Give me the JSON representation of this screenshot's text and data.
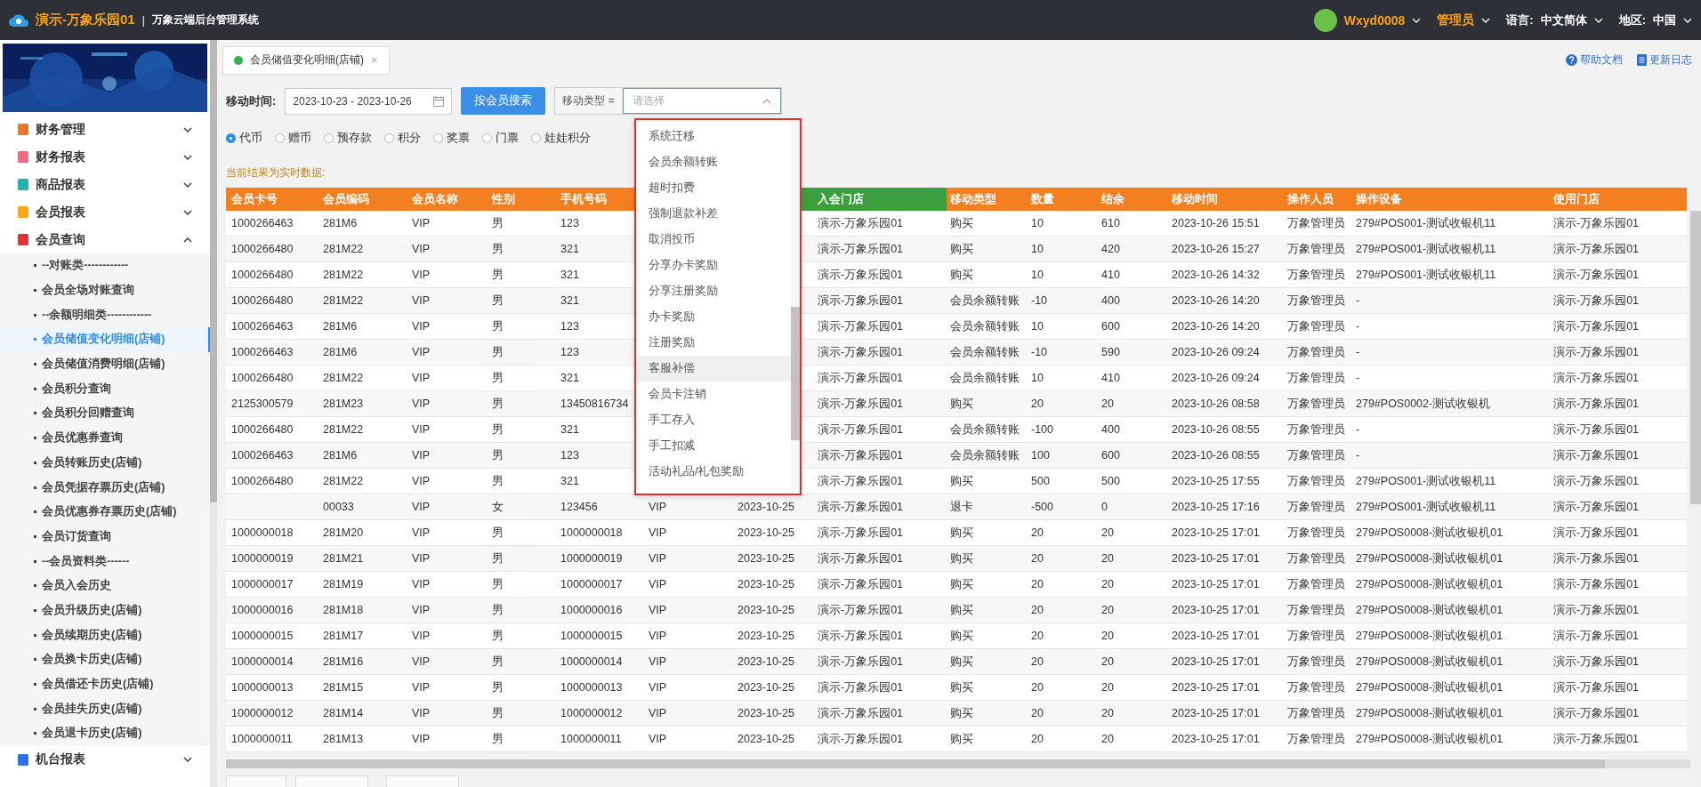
{
  "topbar": {
    "store": "演示-万象乐园01",
    "separator": "|",
    "system": "万象云端后台管理系统",
    "user": "Wxyd0008",
    "role": "管理员",
    "language_label": "语言:",
    "language": "中文简体",
    "region_label": "地区:",
    "region": "中国"
  },
  "sidebar": {
    "items": [
      {
        "label": "财务管理",
        "color": "#e8772e",
        "expanded": false
      },
      {
        "label": "财务报表",
        "color": "#ef6b86",
        "expanded": false
      },
      {
        "label": "商品报表",
        "color": "#27b3a8",
        "expanded": false
      },
      {
        "label": "会员报表",
        "color": "#f5a623",
        "expanded": false
      },
      {
        "label": "会员查询",
        "color": "#d9363e",
        "expanded": true,
        "children": [
          {
            "label": "--对账类------------",
            "selected": false
          },
          {
            "label": "会员全场对账查询",
            "selected": false
          },
          {
            "label": "--余额明细类------------",
            "selected": false
          },
          {
            "label": "会员储值变化明细(店铺)",
            "selected": true
          },
          {
            "label": "会员储值消费明细(店铺)",
            "selected": false
          },
          {
            "label": "会员积分查询",
            "selected": false
          },
          {
            "label": "会员积分回赠查询",
            "selected": false
          },
          {
            "label": "会员优惠券查询",
            "selected": false
          },
          {
            "label": "会员转账历史(店铺)",
            "selected": false
          },
          {
            "label": "会员凭据存票历史(店铺)",
            "selected": false
          },
          {
            "label": "会员优惠券存票历史(店铺)",
            "selected": false
          },
          {
            "label": "会员订货查询",
            "selected": false
          },
          {
            "label": "--会员资料类------",
            "selected": false
          },
          {
            "label": "会员入会历史",
            "selected": false
          },
          {
            "label": "会员升级历史(店铺)",
            "selected": false
          },
          {
            "label": "会员续期历史(店铺)",
            "selected": false
          },
          {
            "label": "会员换卡历史(店铺)",
            "selected": false
          },
          {
            "label": "会员借还卡历史(店铺)",
            "selected": false
          },
          {
            "label": "会员挂失历史(店铺)",
            "selected": false
          },
          {
            "label": "会员退卡历史(店铺)",
            "selected": false
          }
        ]
      },
      {
        "label": "机台报表",
        "color": "#2f6fe0",
        "expanded": false
      }
    ]
  },
  "tabs": [
    {
      "label": "会员储值变化明细(店铺)",
      "selected": true,
      "close": "×"
    }
  ],
  "help_links": [
    "帮助文档",
    "更新日志"
  ],
  "filters": {
    "time_label": "移动时间:",
    "date_range": "2023-10-23 - 2023-10-26",
    "search_button": "按会员搜索",
    "type_label": "移动类型 =",
    "type_placeholder": "请选择",
    "type_open": true
  },
  "coin_types": [
    {
      "label": "代币",
      "selected": true
    },
    {
      "label": "赠币",
      "selected": false
    },
    {
      "label": "预存款",
      "selected": false
    },
    {
      "label": "积分",
      "selected": false
    },
    {
      "label": "奖票",
      "selected": false
    },
    {
      "label": "门票",
      "selected": false
    },
    {
      "label": "娃娃积分",
      "selected": false
    }
  ],
  "notice": "当前结果为实时数据:",
  "table": {
    "columns": [
      {
        "label": "会员卡号",
        "highlighted": false
      },
      {
        "label": "会员编码",
        "highlighted": false
      },
      {
        "label": "会员名称",
        "highlighted": false
      },
      {
        "label": "性别",
        "highlighted": false
      },
      {
        "label": "手机号码",
        "highlighted": false
      },
      {},
      {},
      {
        "label": "入会门店",
        "highlighted": true
      },
      {
        "label": "移动类型",
        "highlighted": false
      },
      {
        "label": "数量",
        "highlighted": false
      },
      {
        "label": "结余",
        "highlighted": false
      },
      {
        "label": "移动时间",
        "highlighted": false
      },
      {
        "label": "操作人员",
        "highlighted": false
      },
      {
        "label": "操作设备",
        "highlighted": false
      },
      {
        "label": "使用门店",
        "highlighted": false
      }
    ],
    "rows": [
      [
        "1000266463",
        "281M6",
        "VIP",
        "男",
        "123",
        null,
        null,
        "演示-万象乐园01",
        "购买",
        "10",
        "610",
        "2023-10-26 15:51",
        "万象管理员",
        "279#POS001-测试收银机11",
        "演示-万象乐园01"
      ],
      [
        "1000266480",
        "281M22",
        "VIP",
        "男",
        "321",
        null,
        null,
        "演示-万象乐园01",
        "购买",
        "10",
        "420",
        "2023-10-26 15:27",
        "万象管理员",
        "279#POS001-测试收银机11",
        "演示-万象乐园01"
      ],
      [
        "1000266480",
        "281M22",
        "VIP",
        "男",
        "321",
        null,
        null,
        "演示-万象乐园01",
        "购买",
        "10",
        "410",
        "2023-10-26 14:32",
        "万象管理员",
        "279#POS001-测试收银机11",
        "演示-万象乐园01"
      ],
      [
        "1000266480",
        "281M22",
        "VIP",
        "男",
        "321",
        null,
        null,
        "演示-万象乐园01",
        "会员余额转账",
        "-10",
        "400",
        "2023-10-26 14:20",
        "万象管理员",
        "-",
        "演示-万象乐园01"
      ],
      [
        "1000266463",
        "281M6",
        "VIP",
        "男",
        "123",
        null,
        null,
        "演示-万象乐园01",
        "会员余额转账",
        "10",
        "600",
        "2023-10-26 14:20",
        "万象管理员",
        "-",
        "演示-万象乐园01"
      ],
      [
        "1000266463",
        "281M6",
        "VIP",
        "男",
        "123",
        null,
        null,
        "演示-万象乐园01",
        "会员余额转账",
        "-10",
        "590",
        "2023-10-26 09:24",
        "万象管理员",
        "-",
        "演示-万象乐园01"
      ],
      [
        "1000266480",
        "281M22",
        "VIP",
        "男",
        "321",
        null,
        null,
        "演示-万象乐园01",
        "会员余额转账",
        "10",
        "410",
        "2023-10-26 09:24",
        "万象管理员",
        "-",
        "演示-万象乐园01"
      ],
      [
        "2125300579",
        "281M23",
        "VIP",
        "男",
        "13450816734",
        null,
        null,
        "演示-万象乐园01",
        "购买",
        "20",
        "20",
        "2023-10-26 08:58",
        "万象管理员",
        "279#POS0002-测试收银机",
        "演示-万象乐园01"
      ],
      [
        "1000266480",
        "281M22",
        "VIP",
        "男",
        "321",
        null,
        null,
        "演示-万象乐园01",
        "会员余额转账",
        "-100",
        "400",
        "2023-10-26 08:55",
        "万象管理员",
        "-",
        "演示-万象乐园01"
      ],
      [
        "1000266463",
        "281M6",
        "VIP",
        "男",
        "123",
        null,
        null,
        "演示-万象乐园01",
        "会员余额转账",
        "100",
        "600",
        "2023-10-26 08:55",
        "万象管理员",
        "-",
        "演示-万象乐园01"
      ],
      [
        "1000266480",
        "281M22",
        "VIP",
        "男",
        "321",
        null,
        null,
        "演示-万象乐园01",
        "购买",
        "500",
        "500",
        "2023-10-25 17:55",
        "万象管理员",
        "279#POS001-测试收银机11",
        "演示-万象乐园01"
      ],
      [
        null,
        "00033",
        "VIP",
        "女",
        "123456",
        "VIP",
        "2023-10-25",
        "演示-万象乐园01",
        "退卡",
        "-500",
        "0",
        "2023-10-25 17:16",
        "万象管理员",
        "279#POS001-测试收银机11",
        "演示-万象乐园01"
      ],
      [
        "1000000018",
        "281M20",
        "VIP",
        "男",
        "1000000018",
        "VIP",
        "2023-10-25",
        "演示-万象乐园01",
        "购买",
        "20",
        "20",
        "2023-10-25 17:01",
        "万象管理员",
        "279#POS0008-测试收银机01",
        "演示-万象乐园01"
      ],
      [
        "1000000019",
        "281M21",
        "VIP",
        "男",
        "1000000019",
        "VIP",
        "2023-10-25",
        "演示-万象乐园01",
        "购买",
        "20",
        "20",
        "2023-10-25 17:01",
        "万象管理员",
        "279#POS0008-测试收银机01",
        "演示-万象乐园01"
      ],
      [
        "1000000017",
        "281M19",
        "VIP",
        "男",
        "1000000017",
        "VIP",
        "2023-10-25",
        "演示-万象乐园01",
        "购买",
        "20",
        "20",
        "2023-10-25 17:01",
        "万象管理员",
        "279#POS0008-测试收银机01",
        "演示-万象乐园01"
      ],
      [
        "1000000016",
        "281M18",
        "VIP",
        "男",
        "1000000016",
        "VIP",
        "2023-10-25",
        "演示-万象乐园01",
        "购买",
        "20",
        "20",
        "2023-10-25 17:01",
        "万象管理员",
        "279#POS0008-测试收银机01",
        "演示-万象乐园01"
      ],
      [
        "1000000015",
        "281M17",
        "VIP",
        "男",
        "1000000015",
        "VIP",
        "2023-10-25",
        "演示-万象乐园01",
        "购买",
        "20",
        "20",
        "2023-10-25 17:01",
        "万象管理员",
        "279#POS0008-测试收银机01",
        "演示-万象乐园01"
      ],
      [
        "1000000014",
        "281M16",
        "VIP",
        "男",
        "1000000014",
        "VIP",
        "2023-10-25",
        "演示-万象乐园01",
        "购买",
        "20",
        "20",
        "2023-10-25 17:01",
        "万象管理员",
        "279#POS0008-测试收银机01",
        "演示-万象乐园01"
      ],
      [
        "1000000013",
        "281M15",
        "VIP",
        "男",
        "1000000013",
        "VIP",
        "2023-10-25",
        "演示-万象乐园01",
        "购买",
        "20",
        "20",
        "2023-10-25 17:01",
        "万象管理员",
        "279#POS0008-测试收银机01",
        "演示-万象乐园01"
      ],
      [
        "1000000012",
        "281M14",
        "VIP",
        "男",
        "1000000012",
        "VIP",
        "2023-10-25",
        "演示-万象乐园01",
        "购买",
        "20",
        "20",
        "2023-10-25 17:01",
        "万象管理员",
        "279#POS0008-测试收银机01",
        "演示-万象乐园01"
      ],
      [
        "1000000011",
        "281M13",
        "VIP",
        "男",
        "1000000011",
        "VIP",
        "2023-10-25",
        "演示-万象乐园01",
        "购买",
        "20",
        "20",
        "2023-10-25 17:01",
        "万象管理员",
        "279#POS0008-测试收银机01",
        "演示-万象乐园01"
      ]
    ]
  },
  "dropdown": {
    "annotated": true,
    "options": [
      {
        "label": "系统迁移",
        "hovered": false
      },
      {
        "label": "会员余额转账",
        "hovered": false
      },
      {
        "label": "超时扣费",
        "hovered": false
      },
      {
        "label": "强制退款补差",
        "hovered": false
      },
      {
        "label": "取消投币",
        "hovered": false
      },
      {
        "label": "分享办卡奖励",
        "hovered": false
      },
      {
        "label": "分享注册奖励",
        "hovered": false
      },
      {
        "label": "办卡奖励",
        "hovered": false
      },
      {
        "label": "注册奖励",
        "hovered": false
      },
      {
        "label": "客服补偿",
        "hovered": true
      },
      {
        "label": "会员卡注销",
        "hovered": false
      },
      {
        "label": "手工存入",
        "hovered": false
      },
      {
        "label": "手工扣减",
        "hovered": false
      },
      {
        "label": "活动礼品/礼包奖励",
        "hovered": false
      }
    ]
  }
}
